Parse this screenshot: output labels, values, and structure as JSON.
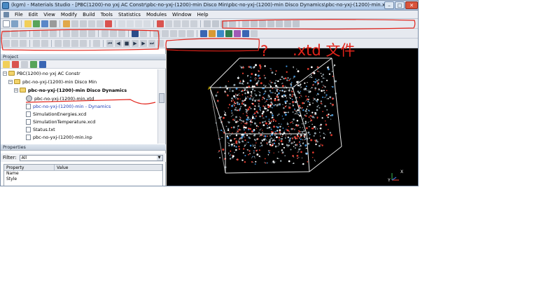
{
  "window": {
    "title": "(kgm) - Materials Studio - [PBC(1200)-no yxj AC Constr\\pbc-no-yxj-(1200)-min Disco Min\\pbc-no-yxj-(1200)-min Disco Dynamics\\pbc-no-yxj-(1200)-min.xtd]",
    "minimize": "–",
    "maximize": "□",
    "close": "✕"
  },
  "menubar": {
    "items": [
      "File",
      "Edit",
      "View",
      "Modify",
      "Build",
      "Tools",
      "Statistics",
      "Modules",
      "Window",
      "Help"
    ]
  },
  "project": {
    "header": "Project",
    "tree": [
      {
        "label": "PBC(1200)-no yxj AC Constr",
        "icon": "folder-icon",
        "bold": false
      },
      {
        "label": "pbc-no-yxj-(1200)-min Disco Min",
        "icon": "folder-icon",
        "bold": false
      },
      {
        "label": "pbc-no-yxj-(1200)-min Disco Dynamics",
        "icon": "folder-icon",
        "bold": true
      },
      {
        "label": "pbc-no-yxj-(1200)-min.xtd",
        "icon": "trajectory-icon",
        "bold": false
      },
      {
        "label": "pbc-no-yxj-(1200)-min - Dynamics",
        "icon": "chart-doc-icon",
        "bold": false
      },
      {
        "label": "SimulationEnergies.xcd",
        "icon": "chart-doc-icon",
        "bold": false
      },
      {
        "label": "SimulationTemperature.xcd",
        "icon": "chart-doc-icon",
        "bold": false
      },
      {
        "label": "Status.txt",
        "icon": "text-doc-icon",
        "bold": false
      },
      {
        "label": "pbc-no-yxj-(1200)-min.inp",
        "icon": "text-doc-icon",
        "bold": false
      }
    ]
  },
  "properties": {
    "header": "Properties",
    "filter_label": "Filter:",
    "filter_value": "All",
    "columns": [
      "Property",
      "Value"
    ],
    "rows": [
      "Name",
      "Style"
    ]
  },
  "viewport": {
    "axis_y": "Y",
    "axis_x": "X",
    "cell_origin": "A"
  },
  "annotations": {
    "question_mark": "?",
    "xtd_note": ".xtd 文件"
  },
  "colors": {
    "annotation": "#e2231a",
    "viewport_bg": "#000000",
    "oxygen": "#e23b2e",
    "carbon": "#8fa0a8",
    "hydrogen": "#ffffff",
    "nitrogen": "#3c8fd6"
  }
}
